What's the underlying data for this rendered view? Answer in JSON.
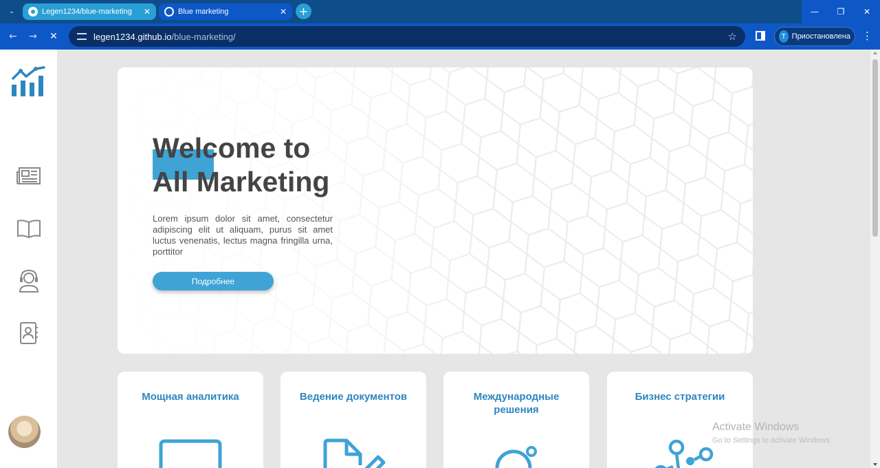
{
  "browser": {
    "tabs": [
      {
        "title": "Legen1234/blue-marketing",
        "close": "✕"
      },
      {
        "title": "Blue marketing",
        "close": "✕"
      }
    ],
    "new_tab": "+",
    "tab_menu": "⌄",
    "window_controls": {
      "minimize": "—",
      "restore": "❐",
      "close": "✕"
    },
    "nav": {
      "back": "←",
      "forward": "→",
      "stop": "✕"
    },
    "url_host": "legen1234.github.io",
    "url_path": "/blue-marketing/",
    "bookmark_star": "☆",
    "profile": {
      "initial": "T",
      "status": "Приостановлена"
    },
    "menu": "⋮"
  },
  "hero": {
    "title_line1": "Welcome to",
    "title_line2": "All Marketing",
    "description": "Lorem ipsum dolor sit amet, consectetur adipiscing elit ut aliquam, purus sit amet luctus venenatis, lectus magna fringilla urna, porttitor",
    "button_label": "Подробнее"
  },
  "cards": [
    {
      "title": "Мощная аналитика",
      "icon": "monitor-icon"
    },
    {
      "title": "Ведение документов",
      "icon": "document-edit-icon"
    },
    {
      "title": "Международные решения",
      "icon": "globe-icon"
    },
    {
      "title": "Бизнес стратегии",
      "icon": "network-icon"
    }
  ],
  "sidebar": {
    "logo": "chart-logo-icon",
    "items": [
      "newspaper-icon",
      "book-icon",
      "support-agent-icon",
      "contacts-icon"
    ]
  },
  "watermark": {
    "title": "Activate Windows",
    "subtitle": "Go to Settings to activate Windows."
  },
  "colors": {
    "accent": "#3fa3d6",
    "title": "#2e86c1",
    "chrome": "#0d58c6"
  }
}
